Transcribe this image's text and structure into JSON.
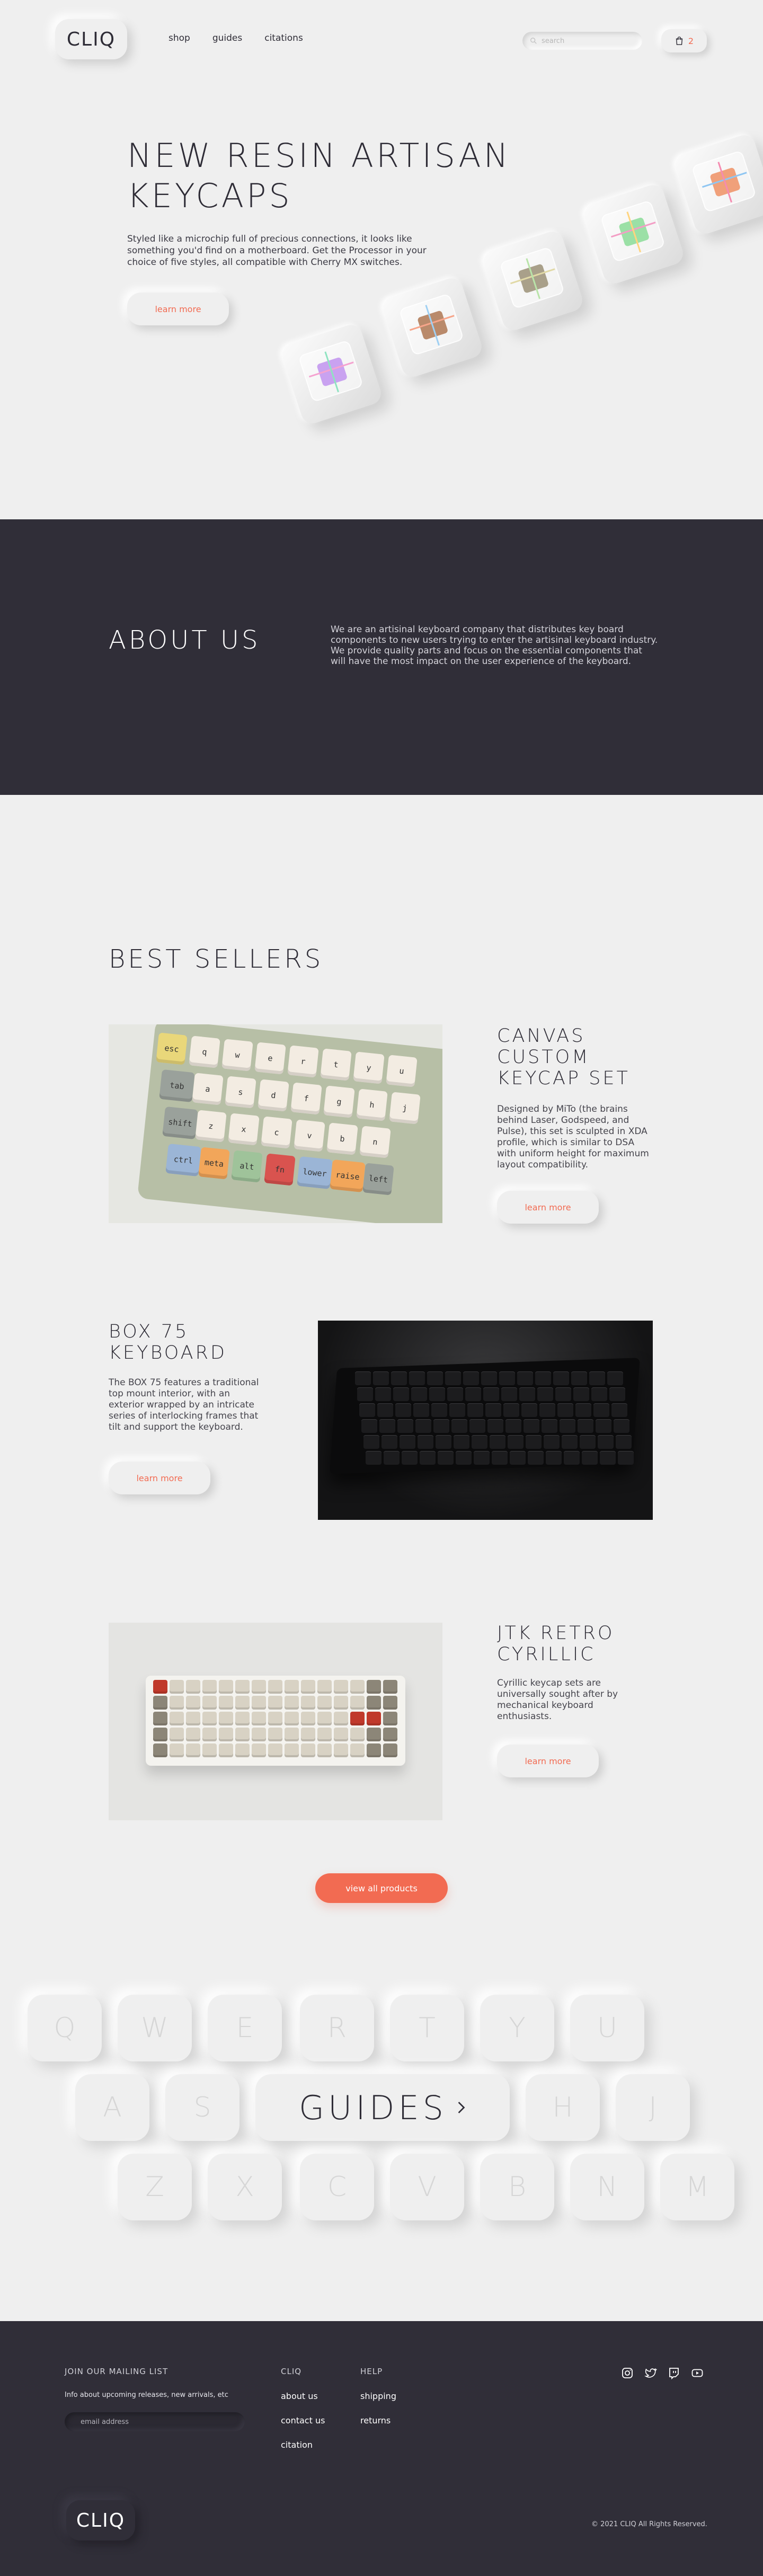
{
  "header": {
    "logo": "CLIQ",
    "nav": [
      "shop",
      "guides",
      "citations"
    ],
    "search_placeholder": "search",
    "cart_count": "2",
    "cart_icon": "bag-icon",
    "search_icon": "search-icon"
  },
  "hero": {
    "title": "NEW RESIN ARTISAN KEYCAPS",
    "description": "Styled like a microchip full of precious connections, it looks like something you'd find on a motherboard. Get the Processor in your choice of five styles, all compatible with Cherry MX switches.",
    "button": "learn more"
  },
  "about": {
    "title": "ABOUT US",
    "text": "We are an artisinal keyboard company that distributes key board components to new users trying to enter the artisinal keyboard industry. We provide quality parts and focus on the essential components that will have the most impact on the user experience of the keyboard."
  },
  "best_sellers": {
    "title": "BEST SELLERS",
    "products": [
      {
        "title": "CANVAS CUSTOM KEYCAP SET",
        "description": "Designed by MiTo (the brains behind Laser, Godspeed, and Pulse), this set is sculpted in XDA profile, which is similar to DSA with uniform height for maximum layout compatibility.",
        "button": "learn more",
        "keys": [
          "esc",
          "q",
          "w",
          "e",
          "r",
          "t",
          "y",
          "u",
          "tab",
          "a",
          "s",
          "d",
          "f",
          "g",
          "h",
          "j",
          "shift",
          "z",
          "x",
          "c",
          "v",
          "b",
          "n",
          "ctrl",
          "meta",
          "alt",
          "fn",
          "lower",
          "raise",
          "left"
        ]
      },
      {
        "title": "BOX 75 KEYBOARD",
        "description": "The BOX 75 features a traditional top mount interior, with an exterior wrapped by an intricate series of interlocking frames that tilt and support the keyboard.",
        "button": "learn more"
      },
      {
        "title": "JTK RETRO CYRILLIC",
        "description": "Cyrillic keycap sets are universally sought after by mechanical keyboard enthusiasts.",
        "button": "learn more"
      }
    ],
    "view_all": "view all products"
  },
  "guides": {
    "row1": [
      "Q",
      "W",
      "E",
      "R",
      "T",
      "Y",
      "U"
    ],
    "row2_left": [
      "A",
      "S"
    ],
    "cta": "GUIDES",
    "row2_right": [
      "H",
      "J"
    ],
    "row3": [
      "Z",
      "X",
      "C",
      "V",
      "B",
      "N",
      "M"
    ]
  },
  "footer": {
    "mailing_title": "JOIN OUR MAILING LIST",
    "mailing_sub": "Info about upcoming releases, new arrivals, etc",
    "email_placeholder": "email address",
    "col1_title": "CLIQ",
    "col1_links": [
      "about us",
      "contact us",
      "citation"
    ],
    "col2_title": "HELP",
    "col2_links": [
      "shipping",
      "returns"
    ],
    "social_icons": [
      "instagram-icon",
      "twitter-icon",
      "twitch-icon",
      "youtube-icon"
    ],
    "logo": "CLIQ",
    "copyright": "© 2021 CLIQ All Rights Reserved."
  },
  "colors": {
    "accent": "#f26b52",
    "dark": "#302e38",
    "background": "#efefef"
  }
}
